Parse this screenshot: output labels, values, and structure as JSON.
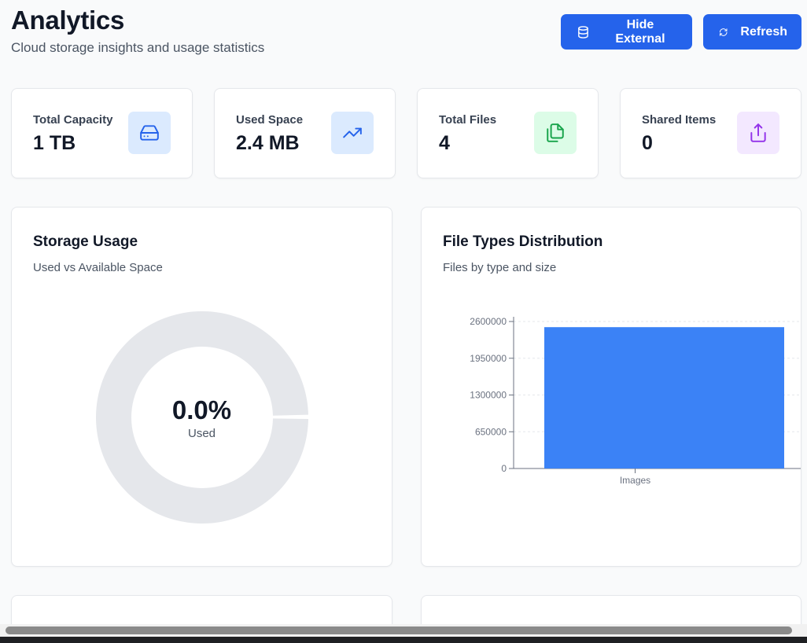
{
  "header": {
    "title": "Analytics",
    "subtitle": "Cloud storage insights and usage statistics"
  },
  "actions": {
    "hide_external_label": "Hide External",
    "refresh_label": "Refresh"
  },
  "stats": [
    {
      "label": "Total Capacity",
      "value": "1 TB",
      "icon": "hard-drive-icon",
      "color": "#2563eb",
      "bg": "#dbeafe"
    },
    {
      "label": "Used Space",
      "value": "2.4 MB",
      "icon": "trending-up-icon",
      "color": "#2563eb",
      "bg": "#dbeafe"
    },
    {
      "label": "Total Files",
      "value": "4",
      "icon": "files-icon",
      "color": "#16a34a",
      "bg": "#dcfce7"
    },
    {
      "label": "Shared Items",
      "value": "0",
      "icon": "share-icon",
      "color": "#9333ea",
      "bg": "#f3e8ff"
    }
  ],
  "storage_usage": {
    "title": "Storage Usage",
    "subtitle": "Used vs Available Space",
    "percent_label": "0.0%",
    "center_caption": "Used",
    "used_fraction": 0.0,
    "ring_color": "#e5e7eb"
  },
  "file_types": {
    "title": "File Types Distribution",
    "subtitle": "Files by type and size"
  },
  "chart_data": {
    "type": "bar",
    "categories": [
      "Images"
    ],
    "values": [
      2500000
    ],
    "ylim": [
      0,
      2600000
    ],
    "yticks": [
      "0",
      "650000",
      "1300000",
      "1950000",
      "2600000"
    ],
    "bar_color": "#3b82f6",
    "grid": true
  }
}
